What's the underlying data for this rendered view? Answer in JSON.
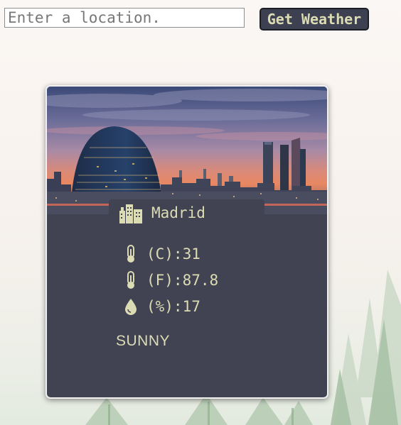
{
  "search": {
    "placeholder": "Enter a location.",
    "value": "",
    "button_label": "Get Weather"
  },
  "weather": {
    "city": "Madrid",
    "celsius": "(C):31",
    "fahrenheit": "(F):87.8",
    "humidity": "(%):17",
    "condition": "SUNNY",
    "icons": {
      "city": "city-buildings-icon",
      "celsius": "thermometer-icon",
      "fahrenheit": "thermometer-icon",
      "humidity": "water-drop-icon"
    }
  },
  "colors": {
    "card_background": "#414252",
    "card_border": "#f1f1f1",
    "text_accent": "#dcdcb4",
    "button_background": "#3d4050",
    "page_background": "#faf6f2"
  }
}
